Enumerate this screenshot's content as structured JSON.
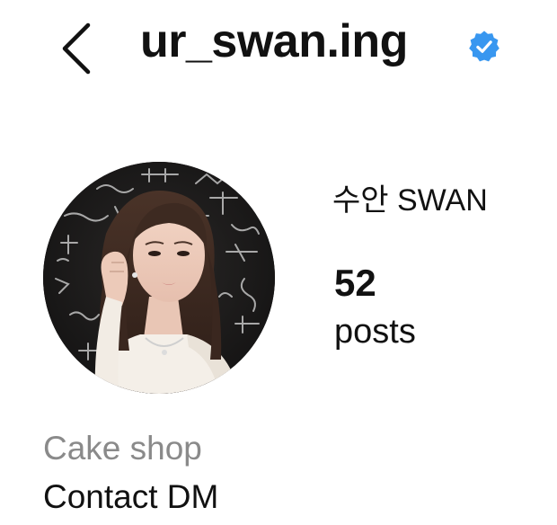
{
  "header": {
    "username": "ur_swan.ing",
    "verified": true,
    "back_icon": "chevron-left-icon",
    "verified_icon": "verified-badge-icon",
    "verified_color": "#3897f0"
  },
  "profile": {
    "display_name": "수안 SWAN",
    "avatar_icon": "profile-photo"
  },
  "stats": {
    "posts": {
      "count": "52",
      "label": "posts"
    }
  },
  "bio": {
    "category": "Cake shop",
    "line": "Contact DM"
  }
}
